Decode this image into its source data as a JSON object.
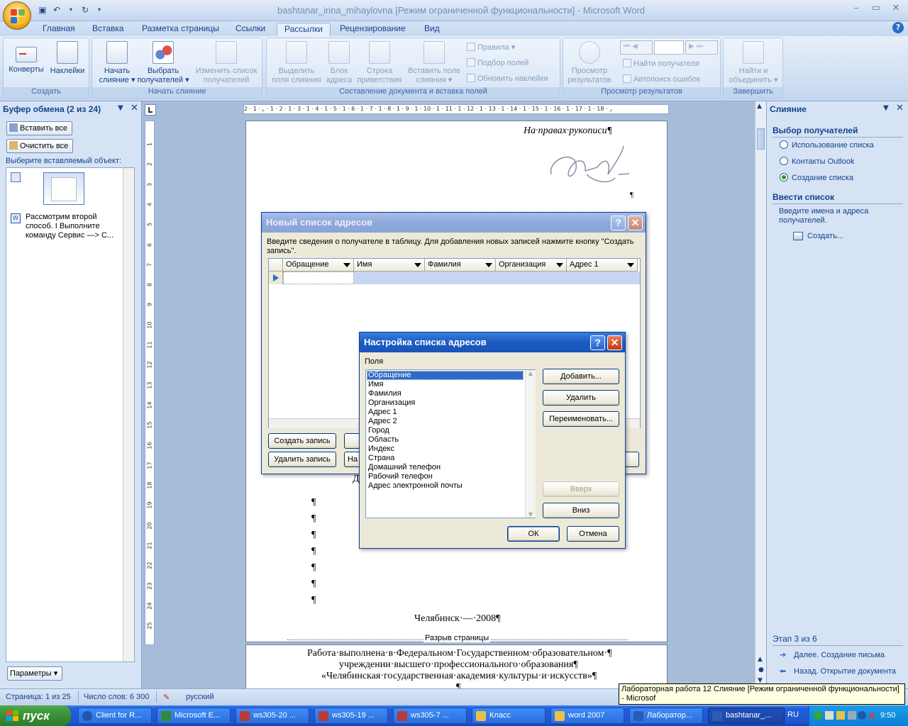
{
  "window": {
    "title": "bashtanar_irina_mihaylovna [Режим ограниченной функциональности] - Microsoft Word"
  },
  "tabs": [
    "Главная",
    "Вставка",
    "Разметка страницы",
    "Ссылки",
    "Рассылки",
    "Рецензирование",
    "Вид"
  ],
  "active_tab": "Рассылки",
  "ribbon": {
    "create": {
      "label": "Создать",
      "envelopes": "Конверты",
      "labels": "Наклейки"
    },
    "start_merge": {
      "label": "Начать слияние",
      "start_l1": "Начать",
      "start_l2": "слияние",
      "select_l1": "Выбрать",
      "select_l2": "получателей",
      "edit_l1": "Изменить список",
      "edit_l2": "получателей"
    },
    "write_insert": {
      "label": "Составление документа и вставка полей",
      "highlight_l1": "Выделить",
      "highlight_l2": "поля слияния",
      "block_l1": "Блок",
      "block_l2": "адреса",
      "greeting_l1": "Строка",
      "greeting_l2": "приветствия",
      "insert_l1": "Вставить поле",
      "insert_l2": "слияния",
      "rules": "Правила",
      "match": "Подбор полей",
      "update": "Обновить наклейки"
    },
    "preview": {
      "label": "Просмотр результатов",
      "preview_l1": "Просмотр",
      "preview_l2": "результатов",
      "find": "Найти получателя",
      "autocheck": "Автопоиск ошибок"
    },
    "finish": {
      "label": "Завершить",
      "finish_l1": "Найти и",
      "finish_l2": "объединить"
    }
  },
  "clipboard": {
    "title": "Буфер обмена (2 из 24)",
    "paste_all": "Вставить все",
    "clear_all": "Очистить все",
    "choose": "Выберите вставляемый объект:",
    "item_text": "Рассмотрим второй способ. I Выполните команду Сервис —> С...",
    "options": "Параметры"
  },
  "merge_pane": {
    "title": "Слияние",
    "section1": "Выбор получателей",
    "opt_use_list": "Использование списка",
    "opt_outlook": "Контакты Outlook",
    "opt_new_list": "Создание списка",
    "section2": "Ввести список",
    "desc": "Введите имена и адреса получателей.",
    "create_link": "Создать...",
    "step": "Этап 3 из 6",
    "next": "Далее. Создание письма",
    "back": "Назад. Открытие документа"
  },
  "ruler_h": "2 · 1 · ⌞ · 1 · 2 · 1 · 3 · 1 · 4 · 1 · 5 · 1 · 6 · 1 · 7 · 1 · 8 · 1 · 9 · 1 · 10 · 1 · 11 · 1 · 12 · 1 · 13 · 1 · 14 · 1 · 15 · 1 · 16 · 1 · 17 · 1 · 18 · ⌟",
  "ruler_v": [
    "1",
    "2",
    "3",
    "4",
    "5",
    "6",
    "7",
    "8",
    "9",
    "10",
    "11",
    "12",
    "13",
    "14",
    "15",
    "16",
    "17",
    "18",
    "19",
    "20",
    "21",
    "22",
    "23",
    "24",
    "25"
  ],
  "document": {
    "manuscript": "На·правах·рукописи¶",
    "pilcrow": "¶",
    "city": "Челябинск·—·2008¶",
    "page_break": "Разрыв страницы",
    "p2_line1": "Работа·выполнена·в·Федеральном·Государственном·образовательном·¶",
    "p2_line2": "учреждении·высшего·профессионального·образования¶",
    "p2_line3": "«Челябинская·государственная·академия·культуры·и·искусств»¶",
    "p2_line4": "¶",
    "dialog_covered": "Д"
  },
  "new_list_dialog": {
    "title": "Новый список адресов",
    "instruction": "Введите сведения о получателе в таблицу. Для добавления новых записей нажмите кнопку \"Создать запись\".",
    "columns": [
      "Обращение",
      "Имя",
      "Фамилия",
      "Организация",
      "Адрес 1"
    ],
    "create_entry": "Создать запись",
    "delete_entry": "Удалить запись",
    "find_partial": "На"
  },
  "customize_dialog": {
    "title": "Настройка списка адресов",
    "fields_label": "Поля",
    "fields": [
      "Обращение",
      "Имя",
      "Фамилия",
      "Организация",
      "Адрес 1",
      "Адрес 2",
      "Город",
      "Область",
      "Индекс",
      "Страна",
      "Домашний телефон",
      "Рабочий телефон",
      "Адрес электронной почты"
    ],
    "add": "Добавить...",
    "delete": "Удалить",
    "rename": "Переименовать...",
    "up": "Вверх",
    "down": "Вниз",
    "ok": "ОК",
    "cancel": "Отмена"
  },
  "status": {
    "page": "Страница: 1 из 25",
    "words": "Число слов: 6 300",
    "lang": "русский"
  },
  "tooltip": "Лабораторная работа 12 Слияние [Режим ограниченной функциональности] - Microsof",
  "taskbar": {
    "start": "пуск",
    "tasks": [
      "Client for R...",
      "Microsoft E...",
      "ws305-20 ...",
      "ws305-19 ...",
      "ws305-7 ...",
      "Класс",
      "word 2007",
      "Лаборатор...",
      "bashtanar_..."
    ],
    "lang": "RU",
    "clock": "9:50"
  },
  "colors": {
    "accent": "#15428b",
    "xp_title": "#1c5bc4",
    "selection": "#316ac5"
  }
}
